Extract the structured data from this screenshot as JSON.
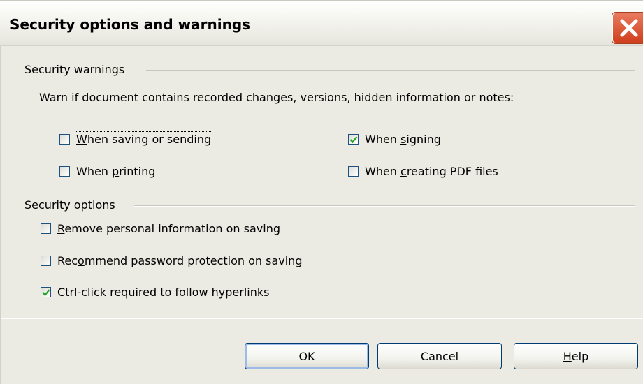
{
  "window": {
    "title": "Security options and warnings",
    "close_icon": "close-icon"
  },
  "warnings": {
    "group_label": "Security warnings",
    "description": "Warn if document contains recorded changes, versions, hidden information or notes:",
    "options": [
      {
        "label": "When saving or sending",
        "mnemonic": "W",
        "checked": false
      },
      {
        "label": "When signing",
        "mnemonic": "s",
        "checked": true
      },
      {
        "label": "When printing",
        "mnemonic": "p",
        "checked": false
      },
      {
        "label": "When creating PDF files",
        "mnemonic": "c",
        "checked": false
      }
    ]
  },
  "options": {
    "group_label": "Security options",
    "items": [
      {
        "label": "Remove personal information on saving",
        "mnemonic": "R",
        "checked": false
      },
      {
        "label": "Recommend password protection on saving",
        "mnemonic": "o",
        "checked": false
      },
      {
        "label": "Ctrl-click required to follow hyperlinks",
        "mnemonic": "t",
        "checked": true
      }
    ]
  },
  "buttons": {
    "ok": "OK",
    "cancel": "Cancel",
    "help": "Help",
    "help_mnemonic": "H"
  },
  "colors": {
    "check": "#21a121",
    "accent": "#003c74",
    "close": "#cf3f1e"
  }
}
